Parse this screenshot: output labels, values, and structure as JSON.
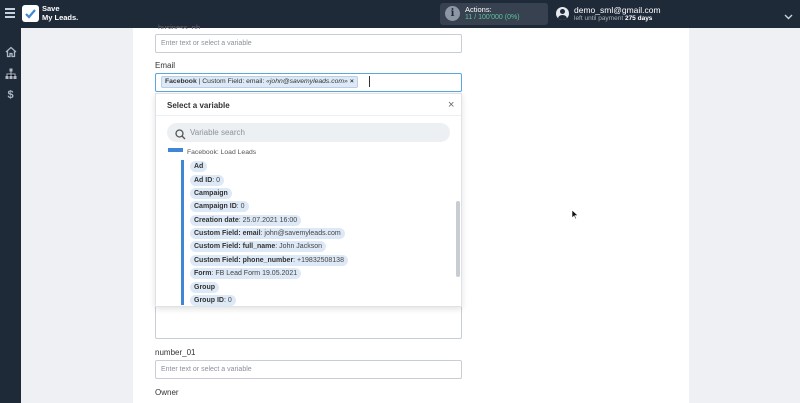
{
  "app": {
    "logo_line1": "Save",
    "logo_line2": "My Leads.",
    "brand_color": "#1f2a38"
  },
  "header": {
    "actions_label": "Actions:",
    "actions_count": "11 / 100'000 (0%)",
    "user_email": "demo_sml@gmail.com",
    "payment_prefix": "left until payment",
    "payment_days": "275 days"
  },
  "sidebar": {
    "items": [
      {
        "icon": "home-icon"
      },
      {
        "icon": "sitemap-icon"
      },
      {
        "icon": "dollar-icon"
      }
    ]
  },
  "form": {
    "top_field_label_partial": "business_ph",
    "top_field_placeholder": "Enter text or select a variable",
    "email_label": "Email",
    "email_tag": {
      "source": "Facebook",
      "field": "| Custom Field: email:",
      "value": "«john@savemyleads.com»",
      "remove": "×"
    },
    "number_label": "number_01",
    "number_placeholder": "Enter text or select a variable",
    "owner_label": "Owner"
  },
  "dropdown": {
    "title": "Select a variable",
    "close": "×",
    "search_placeholder": "Variable search",
    "source": "Facebook: Load Leads",
    "items": [
      {
        "key": "Ad",
        "value": ""
      },
      {
        "key": "Ad ID",
        "value": ": 0"
      },
      {
        "key": "Campaign",
        "value": ""
      },
      {
        "key": "Campaign ID",
        "value": ": 0"
      },
      {
        "key": "Creation date",
        "value": ": 25.07.2021 16:00"
      },
      {
        "key": "Custom Field: email",
        "value": ": john@savemyleads.com"
      },
      {
        "key": "Custom Field: full_name",
        "value": ": John Jackson"
      },
      {
        "key": "Custom Field: phone_number",
        "value": ": +19832508138"
      },
      {
        "key": "Form",
        "value": ": FB Lead Form 19.05.2021"
      },
      {
        "key": "Group",
        "value": ""
      },
      {
        "key": "Group ID",
        "value": ": 0"
      }
    ]
  }
}
